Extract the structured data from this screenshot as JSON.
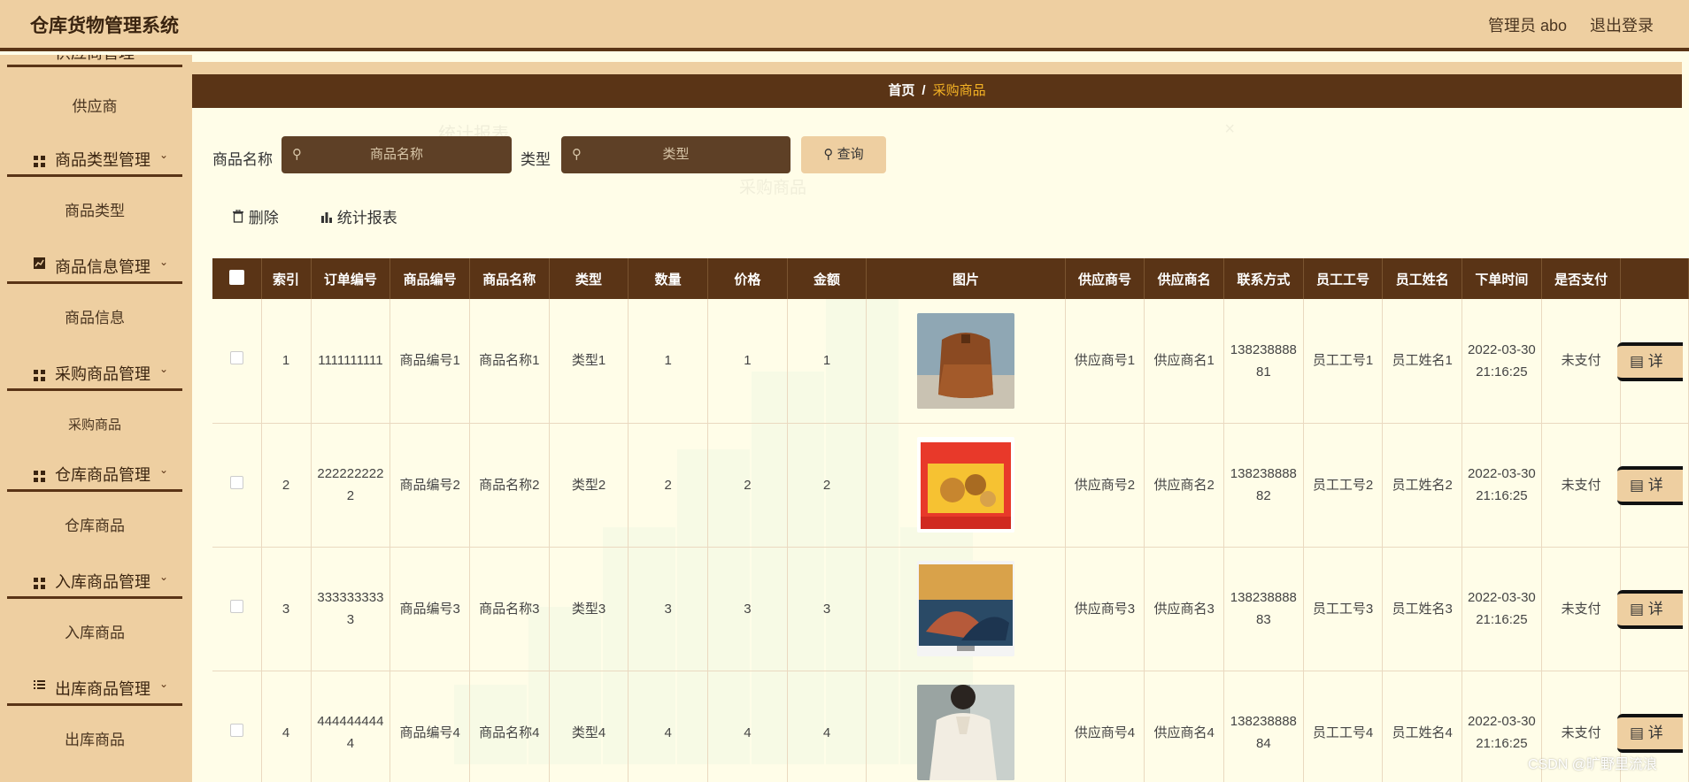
{
  "header": {
    "app_title": "仓库货物管理系统",
    "admin": "管理员 abo",
    "logout": "退出登录"
  },
  "sidebar": {
    "top_cut": "供应商管理",
    "groups": [
      {
        "label": "供应商",
        "type": "sub"
      },
      {
        "label": "商品类型管理",
        "type": "group",
        "icon": "grid-icon"
      },
      {
        "label": "商品类型",
        "type": "sub"
      },
      {
        "label": "商品信息管理",
        "type": "group",
        "icon": "chart-icon"
      },
      {
        "label": "商品信息",
        "type": "sub"
      },
      {
        "label": "采购商品管理",
        "type": "group",
        "icon": "grid-icon"
      },
      {
        "label": "采购商品",
        "type": "sub"
      },
      {
        "label": "仓库商品管理",
        "type": "group",
        "icon": "grid-icon"
      },
      {
        "label": "仓库商品",
        "type": "sub"
      },
      {
        "label": "入库商品管理",
        "type": "group",
        "icon": "grid-icon"
      },
      {
        "label": "入库商品",
        "type": "sub"
      },
      {
        "label": "出库商品管理",
        "type": "group",
        "icon": "list-icon"
      },
      {
        "label": "出库商品",
        "type": "sub"
      }
    ]
  },
  "breadcrumb": {
    "home": "首页",
    "separator": "/",
    "current": "采购商品"
  },
  "ghost_modal": {
    "title": "统计报表",
    "chart_title": "采购商品",
    "close": "×"
  },
  "search": {
    "name_label": "商品名称",
    "name_placeholder": "商品名称",
    "type_label": "类型",
    "type_placeholder": "类型",
    "query_button": "查询"
  },
  "actions": {
    "delete": "删除",
    "report": "统计报表"
  },
  "table": {
    "headers": [
      "索引",
      "订单编号",
      "商品编号",
      "商品名称",
      "类型",
      "数量",
      "价格",
      "金额",
      "图片",
      "供应商号",
      "供应商名",
      "联系方式",
      "员工工号",
      "员工姓名",
      "下单时间",
      "是否支付"
    ],
    "detail_label": "详",
    "rows": [
      {
        "index": "1",
        "order_no": "1111111111",
        "goods_no": "商品编号1",
        "goods_name": "商品名称1",
        "type": "类型1",
        "qty": "1",
        "price": "1",
        "amount": "1",
        "image": "brown-bag",
        "supplier_no": "供应商号1",
        "supplier_name": "供应商名1",
        "contact": "13823888881",
        "emp_no": "员工工号1",
        "emp_name": "员工姓名1",
        "order_time": "2022-03-30 21:16:25",
        "paid": "未支付"
      },
      {
        "index": "2",
        "order_no": "2222222222",
        "goods_no": "商品编号2",
        "goods_name": "商品名称2",
        "type": "类型2",
        "qty": "2",
        "price": "2",
        "amount": "2",
        "image": "snack-box",
        "supplier_no": "供应商号2",
        "supplier_name": "供应商名2",
        "contact": "13823888882",
        "emp_no": "员工工号2",
        "emp_name": "员工姓名2",
        "order_time": "2022-03-30 21:16:25",
        "paid": "未支付"
      },
      {
        "index": "3",
        "order_no": "3333333333",
        "goods_no": "商品编号3",
        "goods_name": "商品名称3",
        "type": "类型3",
        "qty": "3",
        "price": "3",
        "amount": "3",
        "image": "tv-screen",
        "supplier_no": "供应商号3",
        "supplier_name": "供应商名3",
        "contact": "13823888883",
        "emp_no": "员工工号3",
        "emp_name": "员工姓名3",
        "order_time": "2022-03-30 21:16:25",
        "paid": "未支付"
      },
      {
        "index": "4",
        "order_no": "4444444444",
        "goods_no": "商品编号4",
        "goods_name": "商品名称4",
        "type": "类型4",
        "qty": "4",
        "price": "4",
        "amount": "4",
        "image": "white-blouse",
        "supplier_no": "供应商号4",
        "supplier_name": "供应商名4",
        "contact": "13823888884",
        "emp_no": "员工工号4",
        "emp_name": "员工姓名4",
        "order_time": "2022-03-30 21:16:25",
        "paid": "未支付"
      }
    ]
  },
  "watermark": "CSDN @旷野里流浪"
}
